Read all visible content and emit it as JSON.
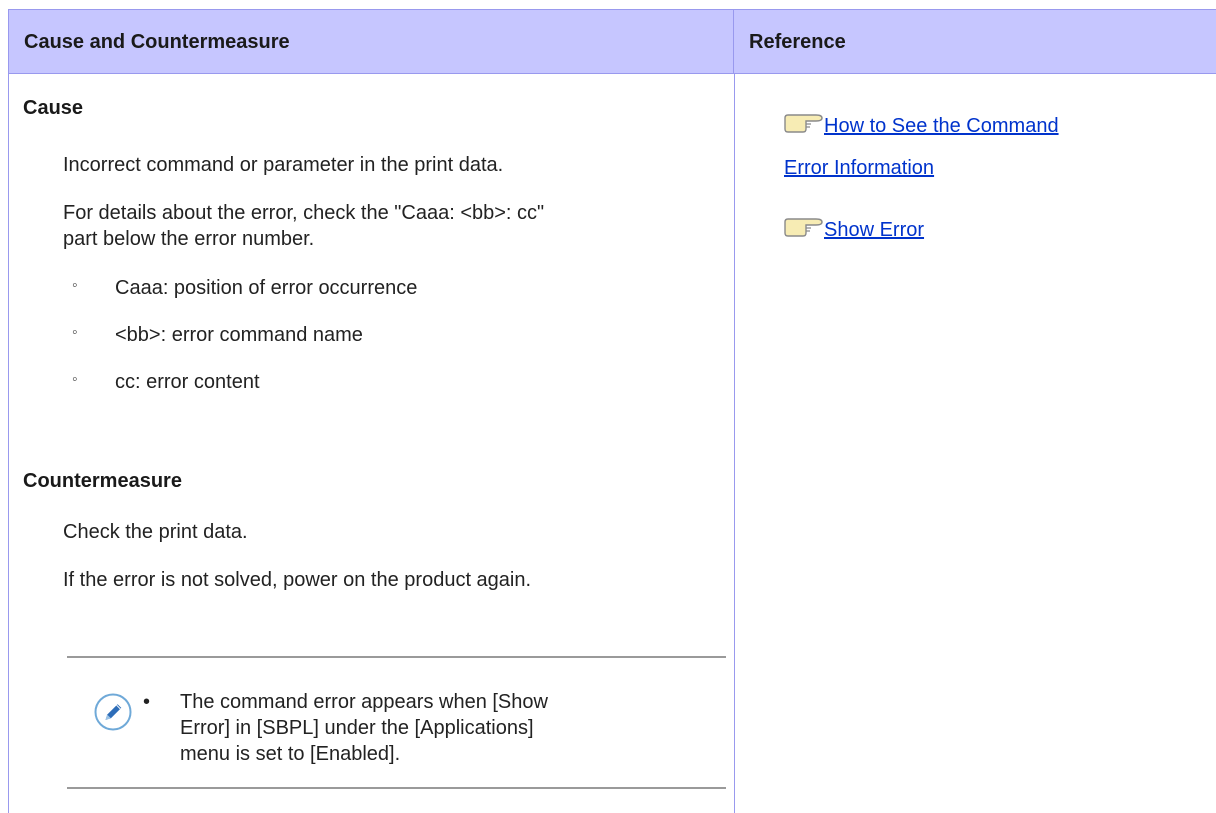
{
  "table": {
    "col_left_header": "Cause and Countermeasure",
    "col_right_header": "Reference"
  },
  "cause": {
    "heading": "Cause",
    "text1": "Incorrect command or parameter in the print data.",
    "text2_line1": "For details about the error, check the \"Caaa: <bb>: cc\"",
    "text2_line2": "part below the error number.",
    "items": [
      "Caaa: position of error occurrence",
      "<bb>: error command name",
      "cc: error content"
    ],
    "bullet_glyph": "◦"
  },
  "countermeasure": {
    "heading": "Countermeasure",
    "text1": "Check the print data.",
    "text2": "If the error is not solved, power on the product again."
  },
  "note": {
    "icon": "pencil-icon",
    "bullet": "•",
    "line1": "The command error appears when [Show",
    "line2": "Error] in [SBPL] under the [Applications]",
    "line3": "menu is set to [Enabled]."
  },
  "references": {
    "icon": "pointing-hand-icon",
    "links": [
      {
        "line1": "How to See the Command",
        "line2": "Error Information"
      },
      {
        "line1": "Show Error"
      }
    ]
  },
  "colors": {
    "header_bg": "#c6c6ff",
    "border": "#9999ee",
    "link": "#0033cc"
  }
}
